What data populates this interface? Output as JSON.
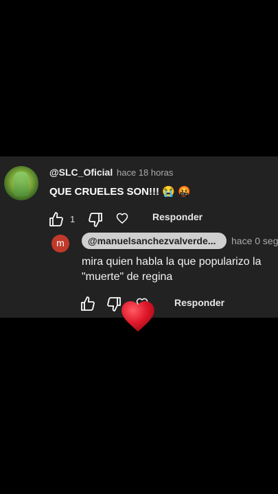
{
  "comment": {
    "handle": "@SLC_Oficial",
    "time": "hace 18 horas",
    "text": "QUE CRUELES SON!!!",
    "emoji_1": "😭",
    "emoji_2": "🤬",
    "like_count": "1",
    "reply_label": "Responder"
  },
  "reply": {
    "avatar_letter": "m",
    "mention": "@manuelsanchezvalverde...",
    "time": "hace 0 seg",
    "text": "mira quien habla la que popularizo la \"muerte\" de regina",
    "reply_label": "Responder"
  },
  "colors": {
    "background": "#000000",
    "panel": "#222222",
    "reply_avatar": "#c0392b",
    "heart": "#e0192b"
  },
  "icons": [
    "thumbs-up-icon",
    "thumbs-down-icon",
    "heart-icon",
    "red-heart-icon"
  ]
}
